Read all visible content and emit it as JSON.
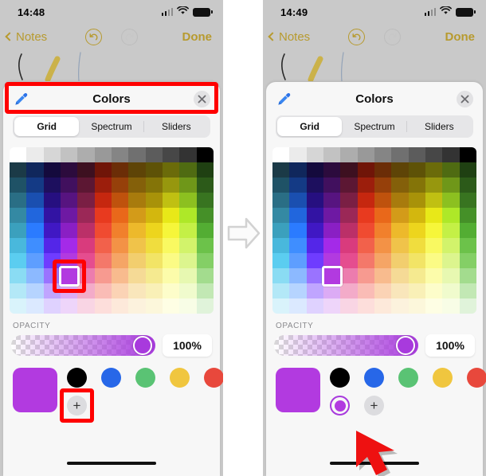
{
  "panels": [
    {
      "id": "before",
      "status": {
        "time": "14:48",
        "signal_icon": "cellular-signal-icon",
        "wifi_icon": "wifi-icon",
        "battery_icon": "battery-icon"
      },
      "nav": {
        "back_label": "Notes",
        "undo_icon": "undo-icon",
        "redo_icon": "redo-icon",
        "done_label": "Done"
      },
      "sheet": {
        "title": "Colors",
        "eyedropper_icon": "eyedropper-icon",
        "close_icon": "close-icon",
        "tabs": [
          {
            "label": "Grid",
            "active": true
          },
          {
            "label": "Spectrum",
            "active": false
          },
          {
            "label": "Sliders",
            "active": false
          }
        ],
        "opacity": {
          "label": "OPACITY",
          "value": "100%",
          "percent": 100
        },
        "preview_color": "#b23ae0",
        "swatch_row_top": [
          {
            "name": "swatch-black",
            "color": "#000000"
          },
          {
            "name": "swatch-blue",
            "color": "#2767e8"
          },
          {
            "name": "swatch-green",
            "color": "#5ac374"
          },
          {
            "name": "swatch-yellow",
            "color": "#f0c63f"
          },
          {
            "name": "swatch-red",
            "color": "#e8483c"
          }
        ],
        "swatch_row_bottom": [
          {
            "name": "add-swatch-button",
            "type": "plus",
            "glyph": "+",
            "highlighted": true
          }
        ],
        "grid_selection": {
          "row": 7,
          "col": 3,
          "color": "#b23ae0",
          "highlighted": true
        }
      }
    },
    {
      "id": "after",
      "status": {
        "time": "14:49",
        "signal_icon": "cellular-signal-icon",
        "wifi_icon": "wifi-icon",
        "battery_icon": "battery-icon"
      },
      "nav": {
        "back_label": "Notes",
        "undo_icon": "undo-icon",
        "redo_icon": "redo-icon",
        "done_label": "Done"
      },
      "sheet": {
        "title": "Colors",
        "eyedropper_icon": "eyedropper-icon",
        "close_icon": "close-icon",
        "tabs": [
          {
            "label": "Grid",
            "active": true
          },
          {
            "label": "Spectrum",
            "active": false
          },
          {
            "label": "Sliders",
            "active": false
          }
        ],
        "opacity": {
          "label": "OPACITY",
          "value": "100%",
          "percent": 100
        },
        "preview_color": "#b23ae0",
        "swatch_row_top": [
          {
            "name": "swatch-black",
            "color": "#000000"
          },
          {
            "name": "swatch-blue",
            "color": "#2767e8"
          },
          {
            "name": "swatch-green",
            "color": "#5ac374"
          },
          {
            "name": "swatch-yellow",
            "color": "#f0c63f"
          },
          {
            "name": "swatch-red",
            "color": "#e8483c"
          }
        ],
        "swatch_row_bottom": [
          {
            "name": "saved-swatch-purple",
            "type": "selected",
            "color": "#b23ae0",
            "highlighted": false
          },
          {
            "name": "add-swatch-button",
            "type": "plus",
            "glyph": "+",
            "highlighted": false
          }
        ],
        "grid_selection": {
          "row": 7,
          "col": 3,
          "color": "#b23ae0",
          "highlighted": false
        }
      }
    }
  ],
  "transition": {
    "arrow_icon": "right-arrow-icon",
    "color": "#d8d8d8"
  },
  "cursor": {
    "icon": "mouse-pointer-arrow-icon",
    "color": "#ee1111"
  },
  "colors": {
    "accent_gold": "#b79a2e",
    "highlight_red": "#ff0000",
    "selected_purple": "#b23ae0"
  },
  "color_grid": {
    "columns": 12,
    "grayscale_row": [
      "#ffffff",
      "#ebebeb",
      "#d6d6d6",
      "#c2c2c2",
      "#adadad",
      "#999999",
      "#858585",
      "#707070",
      "#5c5c5c",
      "#474747",
      "#333333",
      "#000000"
    ],
    "rows": [
      [
        "#1b3a47",
        "#10275c",
        "#140a3d",
        "#2c0b3d",
        "#3d1020",
        "#701508",
        "#6b2d07",
        "#5e4407",
        "#5e5207",
        "#6b6b0a",
        "#4f6b12",
        "#1f4012"
      ],
      [
        "#1f5266",
        "#143a85",
        "#1d0f5e",
        "#41105e",
        "#5c1733",
        "#9c1e0c",
        "#96400a",
        "#84600a",
        "#847408",
        "#97970e",
        "#6f9719",
        "#2c5a19"
      ],
      [
        "#2a6e85",
        "#1a4fb0",
        "#260f80",
        "#571480",
        "#7a1f44",
        "#c6270f",
        "#bf520d",
        "#a87b0d",
        "#a89209",
        "#c0c012",
        "#8cc020",
        "#387420"
      ],
      [
        "#3489a3",
        "#2166dd",
        "#3213a3",
        "#6e19a3",
        "#9b2857",
        "#e83a1f",
        "#e9681a",
        "#d39b19",
        "#d3b70e",
        "#e8e818",
        "#aee828",
        "#459028"
      ],
      [
        "#3ba0bd",
        "#2b7bff",
        "#4018c4",
        "#8a1fc4",
        "#bb3068",
        "#f04b31",
        "#f1802c",
        "#edb92b",
        "#edd51d",
        "#f6f63a",
        "#c4f046",
        "#53ad33"
      ],
      [
        "#49b8dc",
        "#3f8eff",
        "#5426e8",
        "#a42ae8",
        "#d93b7d",
        "#f2614b",
        "#f39246",
        "#f0c34a",
        "#f0dd3e",
        "#f9f961",
        "#d2f36b",
        "#6cc24a"
      ],
      [
        "#5bcdf0",
        "#5e9eff",
        "#6f3cff",
        "#b23ae0",
        "#e54d8f",
        "#f4786a",
        "#f5a566",
        "#f2ce6e",
        "#f2e466",
        "#fbfb85",
        "#dcf58e",
        "#84cf66"
      ],
      [
        "#8adcf3",
        "#8cb9ff",
        "#9a73ff",
        "#c97cf0",
        "#ec7cae",
        "#f79a90",
        "#f8bb8e",
        "#f5da96",
        "#f5ea90",
        "#fcfcaa",
        "#e7f8b1",
        "#a3dc8e"
      ],
      [
        "#b3e8f7",
        "#b6d4ff",
        "#c0a5ff",
        "#dcabf5",
        "#f3abc9",
        "#fabcb6",
        "#fbd3b5",
        "#f9e6bb",
        "#f9f0b7",
        "#fdfdca",
        "#f0fbcd",
        "#c2e8b4"
      ],
      [
        "#d9f3fb",
        "#dbe9ff",
        "#dfd2ff",
        "#eed5fa",
        "#f9d5e4",
        "#fddedb",
        "#fde9da",
        "#fcf2dd",
        "#fcf7db",
        "#fefee4",
        "#f8fde6",
        "#e0f3da"
      ]
    ]
  }
}
